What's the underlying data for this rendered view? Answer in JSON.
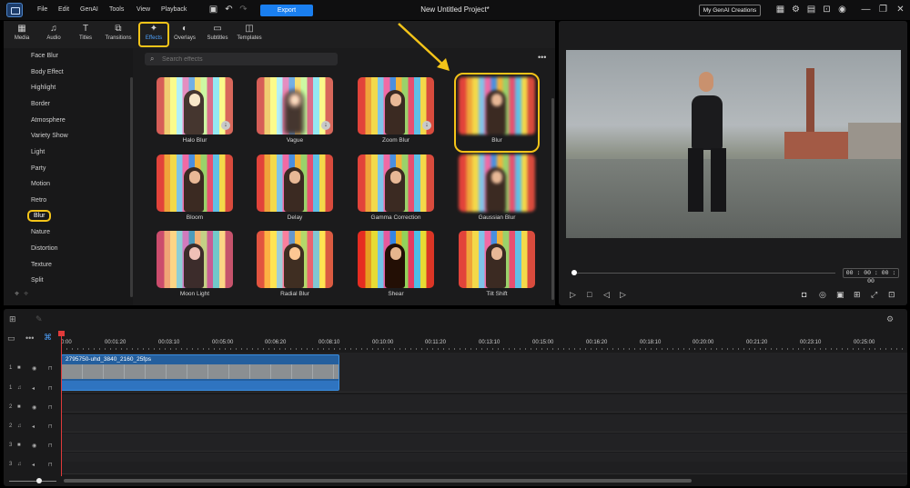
{
  "titlebar": {
    "menus": [
      "File",
      "Edit",
      "GenAI",
      "Tools",
      "View",
      "Playback"
    ],
    "export_label": "Export",
    "project_title": "New Untitled Project*",
    "genai_button": "My GenAI Creations"
  },
  "library": {
    "tabs": [
      {
        "label": "Media",
        "icon": "media-icon"
      },
      {
        "label": "Audio",
        "icon": "music-note-icon"
      },
      {
        "label": "Titles",
        "icon": "text-t-icon"
      },
      {
        "label": "Transitions",
        "icon": "transition-icon"
      },
      {
        "label": "Effects",
        "icon": "effects-icon",
        "active": true
      },
      {
        "label": "Overlays",
        "icon": "overlay-icon"
      },
      {
        "label": "Subtitles",
        "icon": "subtitles-icon"
      },
      {
        "label": "Templates",
        "icon": "templates-icon"
      }
    ],
    "categories": [
      "Face Blur",
      "Body Effect",
      "Highlight",
      "Border",
      "Atmosphere",
      "Variety Show",
      "Light",
      "Party",
      "Motion",
      "Retro",
      "Blur",
      "Nature",
      "Distortion",
      "Texture",
      "Split"
    ],
    "active_category": "Blur",
    "search_placeholder": "Search effects",
    "effects": [
      "Halo Blur",
      "Vague",
      "Zoom Blur",
      "Blur",
      "Bloom",
      "Delay",
      "Gamma Correction",
      "Gaussian Blur",
      "Moon Light",
      "Radial Blur",
      "Shear",
      "Tilt Shift"
    ],
    "selected_effect": "Blur"
  },
  "preview": {
    "timecode": "00 : 00 : 00 : 00"
  },
  "timeline": {
    "ruler": [
      "0:00",
      "00:01:20",
      "00:03:10",
      "00:05:00",
      "00:06:20",
      "00:08:10",
      "00:10:00",
      "00:11:20",
      "00:13:10",
      "00:15:00",
      "00:16:20",
      "00:18:10",
      "00:20:00",
      "00:21:20",
      "00:23:10",
      "00:25:00"
    ],
    "tracks": [
      "1",
      "1",
      "2",
      "2",
      "3",
      "3"
    ],
    "clip_name": "2795750-uhd_3840_2160_25fps"
  },
  "colors": {
    "accent": "#1a7ff0",
    "highlight": "#f4c419",
    "playhead": "#e03a3a"
  }
}
